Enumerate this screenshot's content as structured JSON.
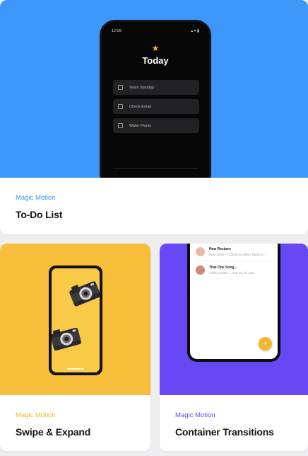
{
  "cards": [
    {
      "category": "Magic Motion",
      "title": "To-Do List",
      "category_color": "#3d97f8",
      "bg_color": "#3d97f8",
      "phone": {
        "time": "12:09",
        "status_icons": "▴ ▾ ▮",
        "star_icon": "star-icon",
        "heading": "Today",
        "tasks": [
          "Team Standup",
          "Check Email",
          "Water Plants"
        ]
      }
    },
    {
      "category": "Magic Motion",
      "title": "Swipe & Expand",
      "category_color": "#f2b52f",
      "bg_color": "#f7be3c",
      "phone": {
        "icons": [
          "camera-icon",
          "camera-icon"
        ]
      }
    },
    {
      "category": "Magic Motion",
      "title": "Container Transitions",
      "category_color": "#6648f5",
      "bg_color": "#6648f5",
      "phone": {
        "messages": [
          {
            "title": "New Recipes",
            "preview": "Mark Lucas — Check out what I found on..."
          },
          {
            "title": "That One Song...",
            "preview": "Ashley Austin — Hear me, if I can't..."
          }
        ],
        "fab_label": "+"
      }
    }
  ]
}
